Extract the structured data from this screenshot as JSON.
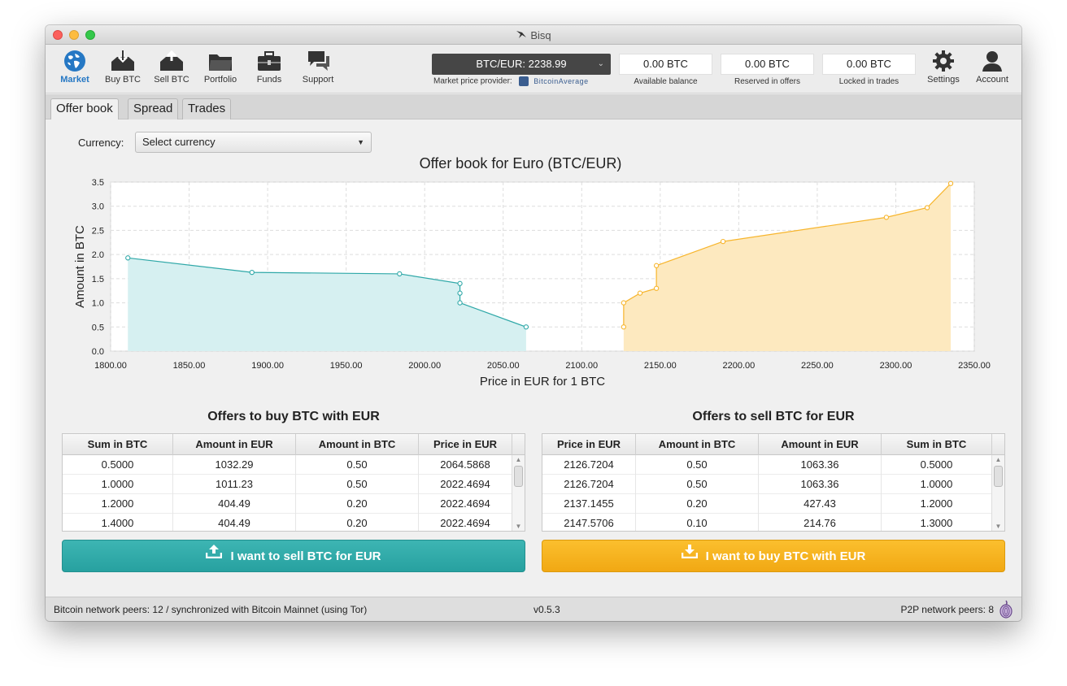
{
  "window": {
    "title": "Bisq"
  },
  "nav": [
    {
      "label": "Market",
      "icon": "globe-icon",
      "active": true
    },
    {
      "label": "Buy BTC",
      "icon": "buy-btc-icon"
    },
    {
      "label": "Sell BTC",
      "icon": "sell-btc-icon"
    },
    {
      "label": "Portfolio",
      "icon": "folder-icon"
    },
    {
      "label": "Funds",
      "icon": "briefcase-icon"
    },
    {
      "label": "Support",
      "icon": "chat-bubbles-icon"
    }
  ],
  "market_price": {
    "value": "BTC/EUR: 2238.99",
    "provider_label": "Market price provider:",
    "provider_name": "BitcoinAverage"
  },
  "balances": [
    {
      "value": "0.00 BTC",
      "label": "Available balance"
    },
    {
      "value": "0.00 BTC",
      "label": "Reserved in offers"
    },
    {
      "value": "0.00 BTC",
      "label": "Locked in trades"
    }
  ],
  "right_nav": [
    {
      "label": "Settings",
      "icon": "gear-icon"
    },
    {
      "label": "Account",
      "icon": "account-icon"
    }
  ],
  "tabs": [
    {
      "label": "Offer book",
      "active": true
    },
    {
      "label": "Spread"
    },
    {
      "label": "Trades"
    }
  ],
  "currency": {
    "label": "Currency:",
    "selected": "Select currency"
  },
  "chart_data": {
    "type": "area",
    "title": "Offer book for Euro (BTC/EUR)",
    "xlabel": "Price in EUR for 1 BTC",
    "ylabel": "Amount in BTC",
    "xlim": [
      1800,
      2350
    ],
    "ylim": [
      0,
      3.5
    ],
    "xticks": [
      "1800.00",
      "1850.00",
      "1900.00",
      "1950.00",
      "2000.00",
      "2050.00",
      "2100.00",
      "2150.00",
      "2200.00",
      "2250.00",
      "2300.00",
      "2350.00"
    ],
    "yticks": [
      "0.0",
      "0.5",
      "1.0",
      "1.5",
      "2.0",
      "2.5",
      "3.0",
      "3.5"
    ],
    "grid": true,
    "series": [
      {
        "color": "#2fa8a8",
        "fill": "#d6f0f1",
        "points": [
          [
            1811,
            1.93
          ],
          [
            1890,
            1.63
          ],
          [
            1984,
            1.6
          ],
          [
            2022.47,
            1.4
          ],
          [
            2022.47,
            1.2
          ],
          [
            2022.47,
            1.0
          ],
          [
            2064.59,
            0.5
          ]
        ]
      },
      {
        "color": "#f7b52c",
        "fill": "#fde9bf",
        "points": [
          [
            2126.72,
            0.5
          ],
          [
            2126.72,
            1.0
          ],
          [
            2137.15,
            1.2
          ],
          [
            2147.57,
            1.3
          ],
          [
            2147.57,
            1.77
          ],
          [
            2190,
            2.27
          ],
          [
            2294,
            2.77
          ],
          [
            2320,
            2.97
          ],
          [
            2335,
            3.47
          ]
        ]
      }
    ]
  },
  "buy_table": {
    "title": "Offers to buy BTC with EUR",
    "columns": [
      "Sum in BTC",
      "Amount in EUR",
      "Amount in BTC",
      "Price in EUR"
    ],
    "rows": [
      [
        "0.5000",
        "1032.29",
        "0.50",
        "2064.5868"
      ],
      [
        "1.0000",
        "1011.23",
        "0.50",
        "2022.4694"
      ],
      [
        "1.2000",
        "404.49",
        "0.20",
        "2022.4694"
      ],
      [
        "1.4000",
        "404.49",
        "0.20",
        "2022.4694"
      ]
    ]
  },
  "sell_table": {
    "title": "Offers to sell BTC for EUR",
    "columns": [
      "Price in EUR",
      "Amount in BTC",
      "Amount in EUR",
      "Sum in BTC"
    ],
    "rows": [
      [
        "2126.7204",
        "0.50",
        "1063.36",
        "0.5000"
      ],
      [
        "2126.7204",
        "0.50",
        "1063.36",
        "1.0000"
      ],
      [
        "2137.1455",
        "0.20",
        "427.43",
        "1.2000"
      ],
      [
        "2147.5706",
        "0.10",
        "214.76",
        "1.3000"
      ]
    ]
  },
  "actions": {
    "sell_label": "I want to sell BTC for EUR",
    "buy_label": "I want to buy BTC with EUR"
  },
  "status": {
    "left": "Bitcoin network peers: 12 / synchronized with Bitcoin Mainnet (using Tor)",
    "version": "v0.5.3",
    "right": "P2P network peers: 8"
  }
}
